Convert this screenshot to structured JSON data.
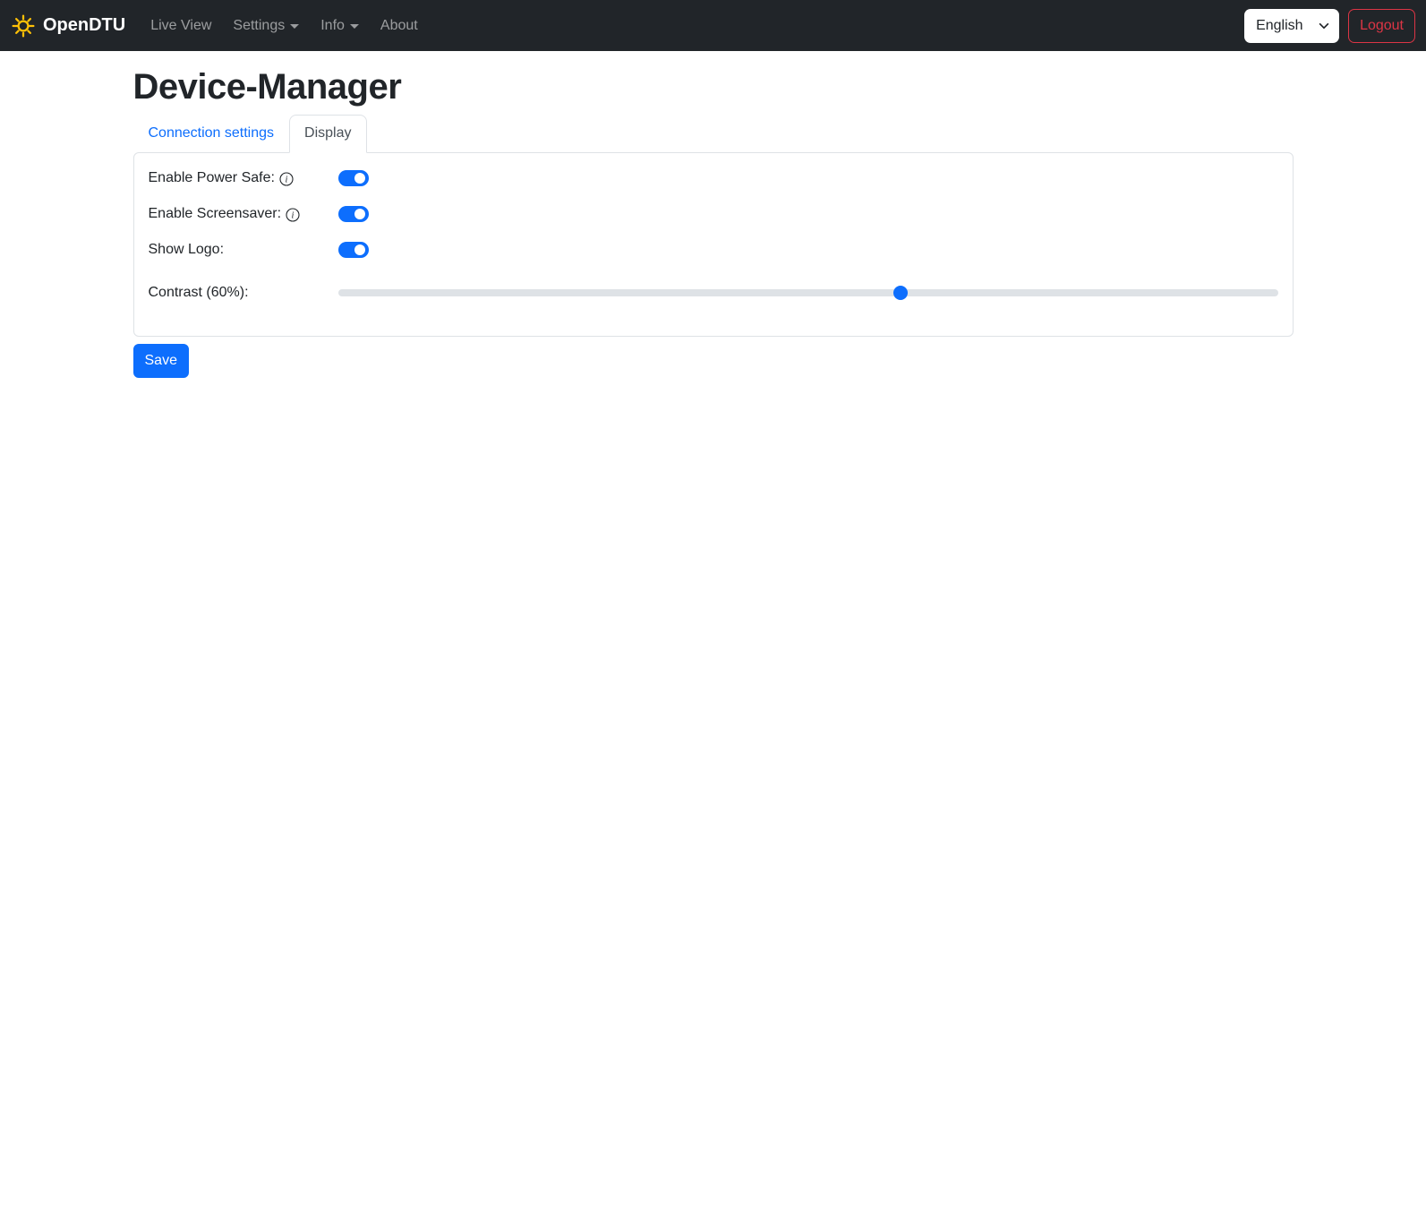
{
  "navbar": {
    "brand": "OpenDTU",
    "links": {
      "live_view": "Live View",
      "settings": "Settings",
      "info": "Info",
      "about": "About"
    },
    "language": {
      "selected": "English"
    },
    "logout_label": "Logout"
  },
  "page": {
    "title": "Device-Manager",
    "tabs": {
      "connection": "Connection settings",
      "display": "Display"
    }
  },
  "form": {
    "power_safe": {
      "label": "Enable Power Safe:",
      "enabled": true,
      "has_info": true
    },
    "screensaver": {
      "label": "Enable Screensaver:",
      "enabled": true,
      "has_info": true
    },
    "show_logo": {
      "label": "Show Logo:",
      "enabled": true,
      "has_info": false
    },
    "contrast": {
      "label": "Contrast (60%):",
      "value_percent": 60
    },
    "save_label": "Save"
  },
  "colors": {
    "accent": "#0d6efd",
    "navbar_bg": "#212529",
    "danger": "#dc3545",
    "brand_icon": "#ffc107",
    "border": "#dee2e6"
  }
}
